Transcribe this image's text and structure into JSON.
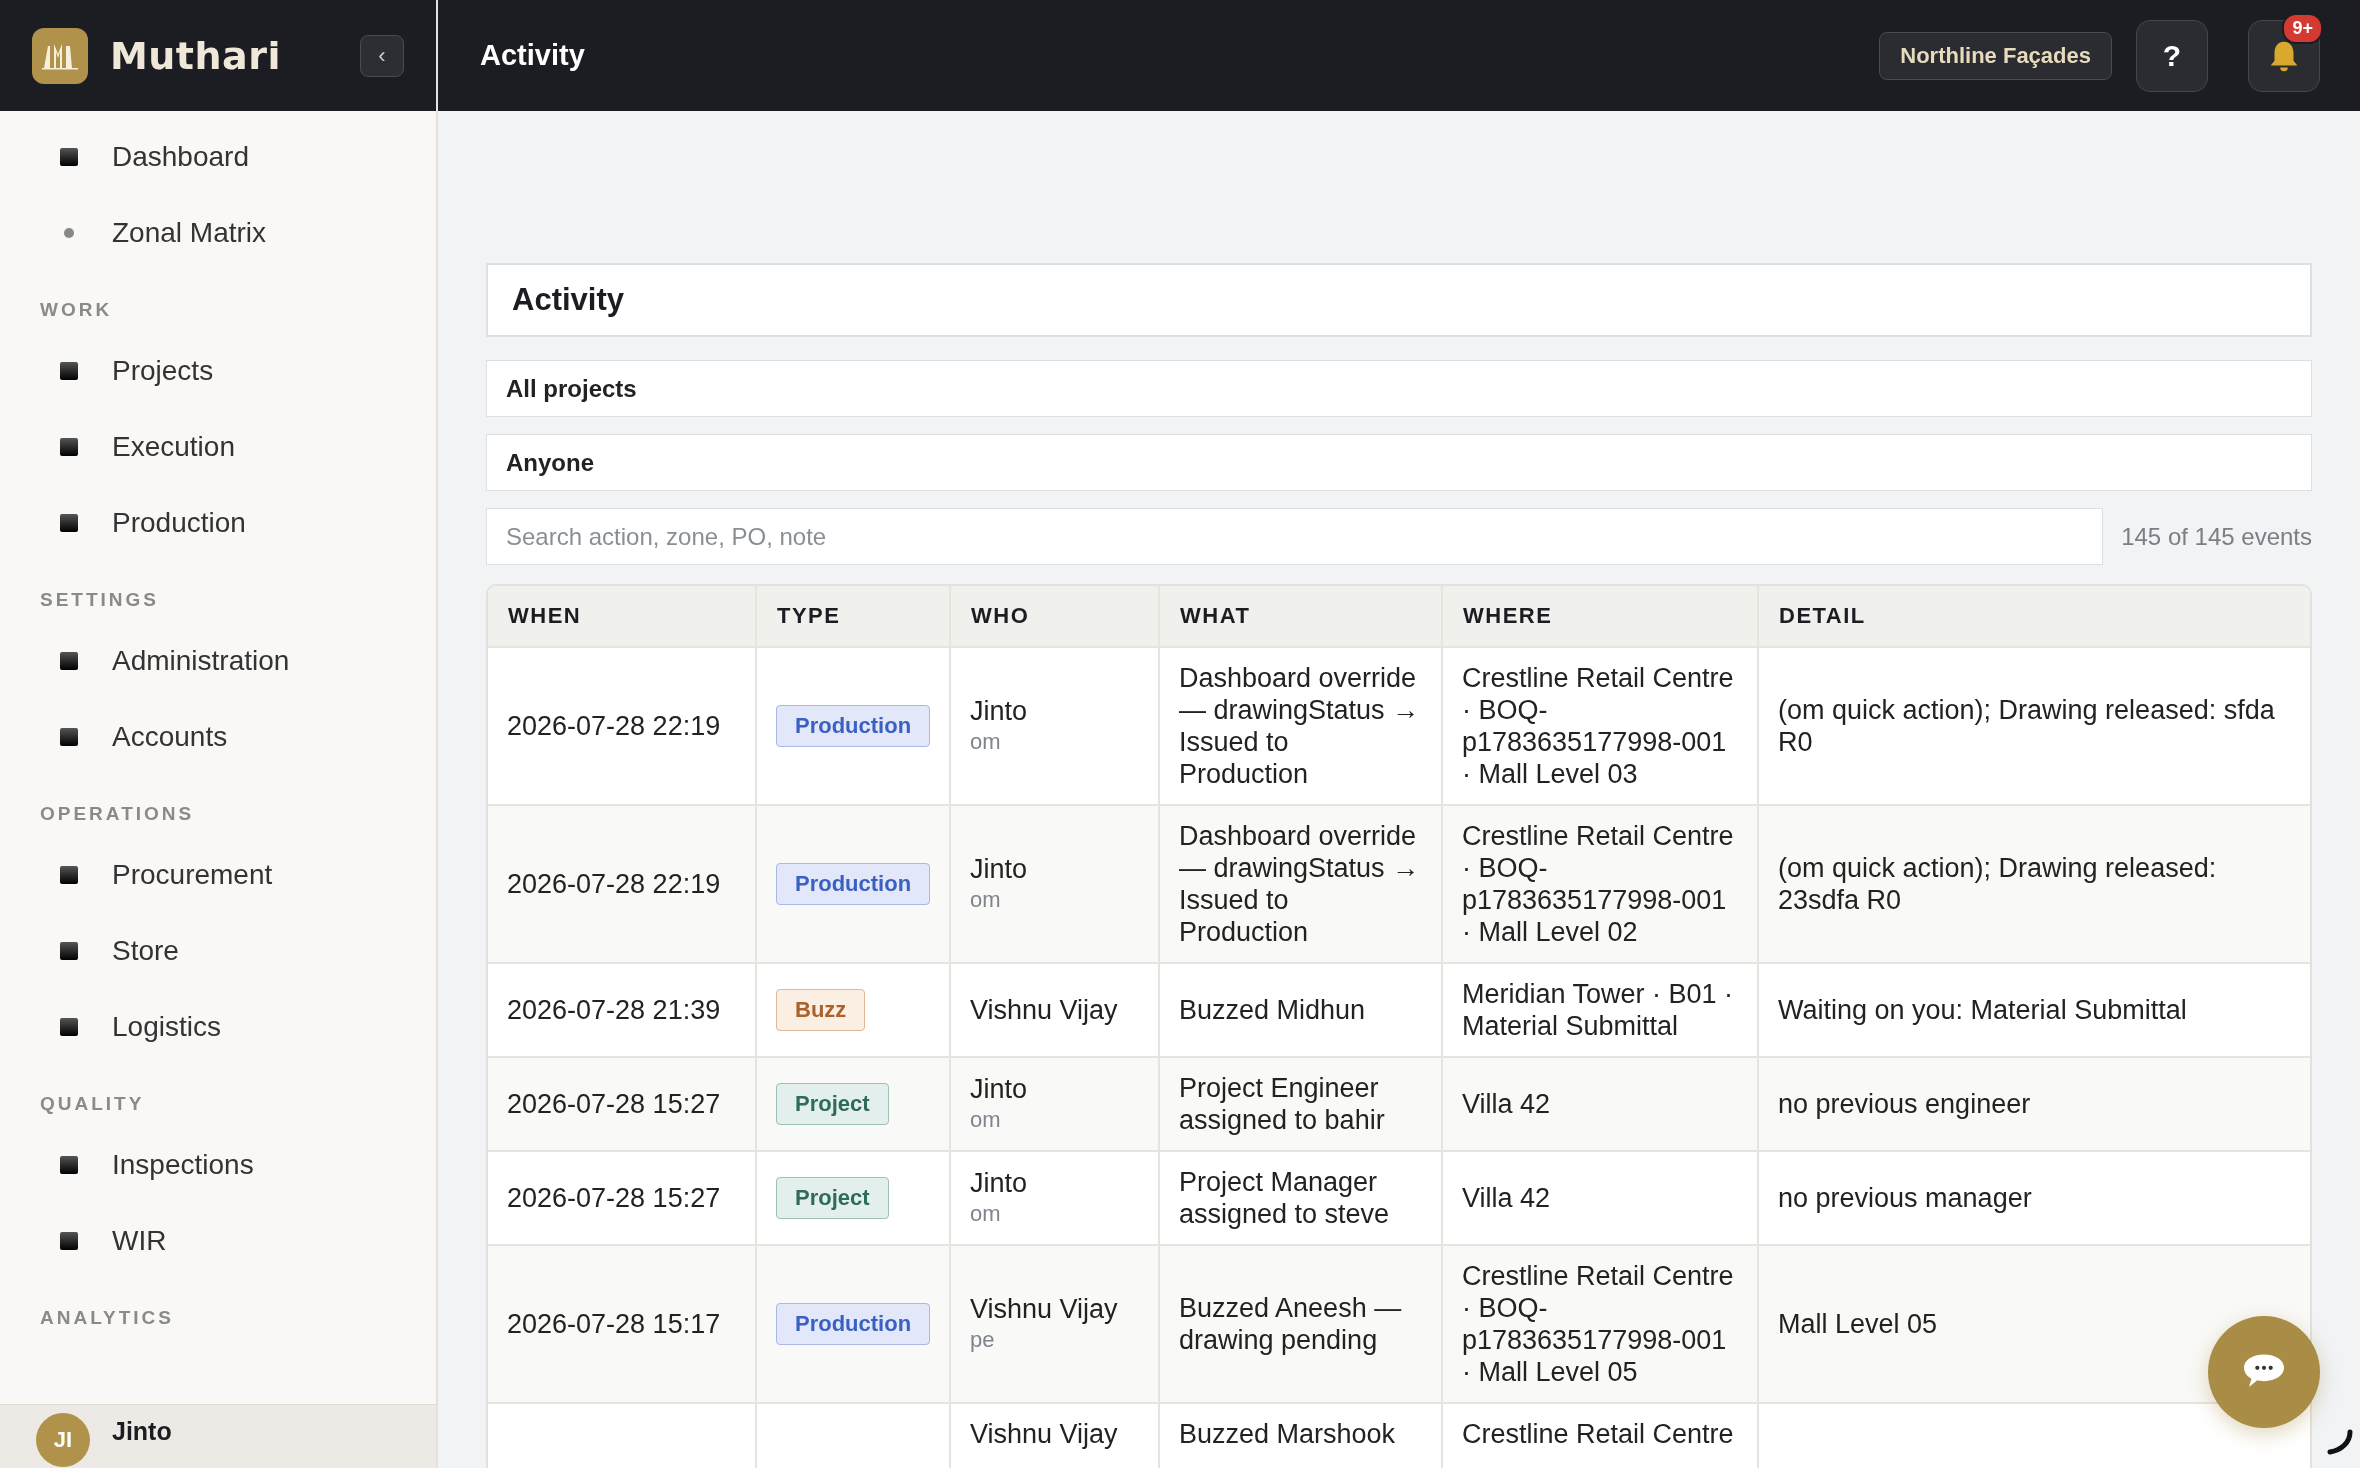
{
  "brand": {
    "name": "Muthari",
    "collapse": "‹"
  },
  "header": {
    "title": "Activity",
    "org": "Northline Façades",
    "help": "?",
    "badge": "9+"
  },
  "sidebar": {
    "groups": [
      {
        "items": [
          {
            "label": "Dashboard",
            "kind": "square"
          },
          {
            "label": "Zonal Matrix",
            "kind": "dot"
          }
        ]
      },
      {
        "label": "WORK",
        "items": [
          {
            "label": "Projects",
            "kind": "square"
          },
          {
            "label": "Execution",
            "kind": "square"
          },
          {
            "label": "Production",
            "kind": "square"
          }
        ]
      },
      {
        "label": "SETTINGS",
        "items": [
          {
            "label": "Administration",
            "kind": "square"
          },
          {
            "label": "Accounts",
            "kind": "square"
          }
        ]
      },
      {
        "label": "OPERATIONS",
        "items": [
          {
            "label": "Procurement",
            "kind": "square"
          },
          {
            "label": "Store",
            "kind": "square"
          },
          {
            "label": "Logistics",
            "kind": "square"
          }
        ]
      },
      {
        "label": "QUALITY",
        "items": [
          {
            "label": "Inspections",
            "kind": "square"
          },
          {
            "label": "WIR",
            "kind": "square"
          }
        ]
      },
      {
        "label": "ANALYTICS"
      }
    ],
    "user": {
      "initials": "JI",
      "name": "Jinto"
    }
  },
  "page": {
    "title": "Activity",
    "project_filter": "All projects",
    "person_filter": "Anyone",
    "search": {
      "placeholder": "Search action, zone, PO, note"
    },
    "count": "145 of 145 events"
  },
  "table": {
    "columns": [
      "WHEN",
      "TYPE",
      "WHO",
      "WHAT",
      "WHERE",
      "DETAIL"
    ],
    "rows": [
      {
        "when": "2026-07-28 22:19",
        "type": "Production",
        "kind": "production",
        "who": "Jinto",
        "role": "om",
        "what": "Dashboard override — drawingStatus → Issued to Production",
        "where": "Crestline Retail Centre · BOQ-p1783635177998-001 · Mall Level 03",
        "detail": "(om quick action); Drawing released: sfda R0"
      },
      {
        "when": "2026-07-28 22:19",
        "type": "Production",
        "kind": "production",
        "who": "Jinto",
        "role": "om",
        "what": "Dashboard override — drawingStatus → Issued to Production",
        "where": "Crestline Retail Centre · BOQ-p1783635177998-001 · Mall Level 02",
        "detail": "(om quick action); Drawing released: 23sdfa R0"
      },
      {
        "when": "2026-07-28 21:39",
        "type": "Buzz",
        "kind": "buzz",
        "who": "Vishnu Vijay",
        "what": "Buzzed Midhun",
        "where": "Meridian Tower · B01 · Material Submittal",
        "detail": "Waiting on you: Material Submittal"
      },
      {
        "when": "2026-07-28 15:27",
        "type": "Project",
        "kind": "project",
        "who": "Jinto",
        "role": "om",
        "what": "Project Engineer assigned to bahir",
        "where": "Villa 42",
        "detail": "no previous engineer"
      },
      {
        "when": "2026-07-28 15:27",
        "type": "Project",
        "kind": "project",
        "who": "Jinto",
        "role": "om",
        "what": "Project Manager assigned to steve",
        "where": "Villa 42",
        "detail": "no previous manager"
      },
      {
        "when": "2026-07-28 15:17",
        "type": "Production",
        "kind": "production",
        "who": "Vishnu Vijay",
        "role": "pe",
        "what": "Buzzed Aneesh — drawing pending",
        "where": "Crestline Retail Centre · BOQ-p1783635177998-001 · Mall Level 05",
        "detail": "Mall Level 05"
      },
      {
        "who": "Vishnu Vijay",
        "what": "Buzzed Marshook",
        "where": "Crestline Retail Centre"
      }
    ]
  }
}
